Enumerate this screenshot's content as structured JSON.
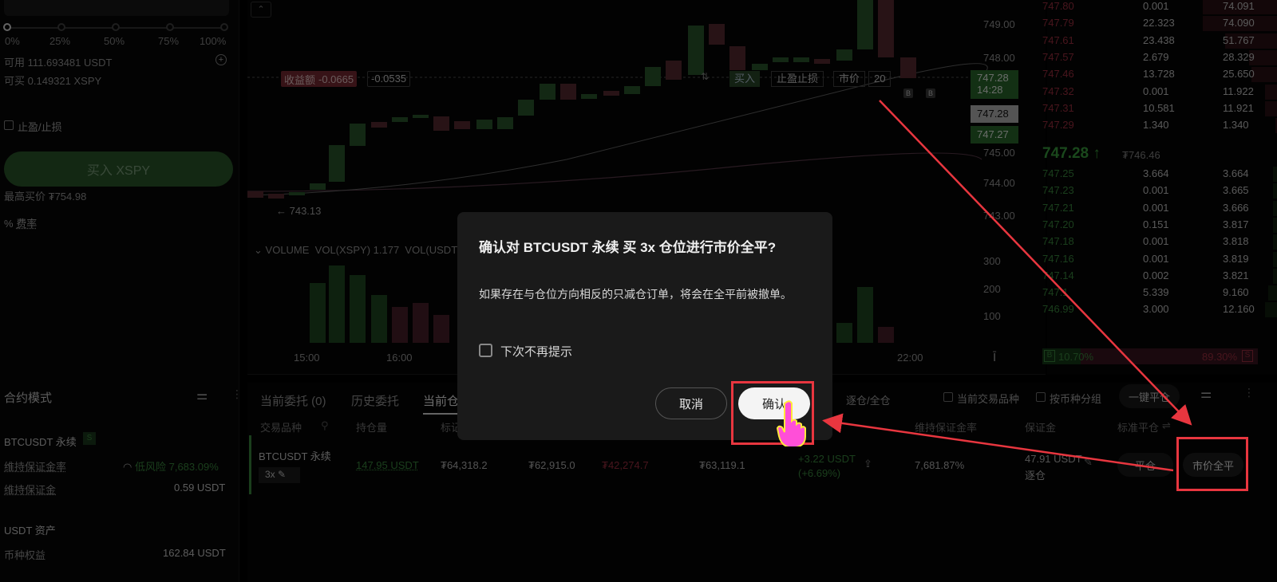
{
  "left_panel": {
    "slider_ticks": [
      "0%",
      "25%",
      "50%",
      "75%",
      "100%"
    ],
    "available_label": "可用",
    "available_value": "111.693481 USDT",
    "can_buy_label": "可买",
    "can_buy_value": "0.149321 XSPY",
    "tp_sl_label": "止盈/止损",
    "buy_button": "买入 XSPY",
    "max_price_label": "最高买价",
    "max_price_value": "₮754.98",
    "fee_label": "费率"
  },
  "chart": {
    "pnl_badge": "收益额",
    "pnl_value1": "-0.0665",
    "pnl_value2": "-0.0535",
    "order_tags": [
      "买入",
      "止盈止损",
      "市价",
      "20"
    ],
    "low_label": "← 743.13",
    "volume_label": "VOLUME",
    "vol_xspy": "VOL(XSPY) 1.177",
    "vol_usdt": "VOL(USDT",
    "x_ticks": [
      "15:00",
      "16:00",
      "22:00"
    ],
    "price_scale": [
      "749.00",
      "748.00",
      "747.28",
      "14:28",
      "747.28",
      "747.27",
      "745.00",
      "744.00",
      "743.00"
    ],
    "vol_scale": [
      "300",
      "200",
      "100"
    ]
  },
  "order_book": {
    "asks": [
      [
        "747.80",
        "0.001",
        "74.091"
      ],
      [
        "747.79",
        "22.323",
        "74.090"
      ],
      [
        "747.61",
        "23.438",
        "51.767"
      ],
      [
        "747.57",
        "2.679",
        "28.329"
      ],
      [
        "747.46",
        "13.728",
        "25.650"
      ],
      [
        "747.32",
        "0.001",
        "11.922"
      ],
      [
        "747.31",
        "10.581",
        "11.921"
      ],
      [
        "747.29",
        "1.340",
        "1.340"
      ]
    ],
    "last_price": "747.28 ↑",
    "mark_price": "₮746.46",
    "bids": [
      [
        "747.25",
        "3.664",
        "3.664"
      ],
      [
        "747.23",
        "0.001",
        "3.665"
      ],
      [
        "747.21",
        "0.001",
        "3.666"
      ],
      [
        "747.20",
        "0.151",
        "3.817"
      ],
      [
        "747.18",
        "0.001",
        "3.818"
      ],
      [
        "747.16",
        "0.001",
        "3.819"
      ],
      [
        "747.14",
        "0.002",
        "3.821"
      ],
      [
        "747.1",
        "5.339",
        "9.160"
      ],
      [
        "746.99",
        "3.000",
        "12.160"
      ]
    ],
    "buy_ratio": "10.70%",
    "sell_ratio": "89.30%",
    "b_label": "B",
    "s_label": "S"
  },
  "bottom_left": {
    "title": "合约模式",
    "symbol": "BTCUSDT 永续",
    "maint_rate_label": "维持保证金率",
    "risk_label": "低风险",
    "risk_value": "7,683.09%",
    "maint_margin_label": "维持保证金",
    "maint_margin_value": "0.59 USDT",
    "asset_title": "USDT 资产",
    "equity_label": "币种权益",
    "equity_value": "162.84 USDT"
  },
  "bottom": {
    "tabs": [
      "当前委托 (0)",
      "历史委托",
      "当前仓"
    ],
    "margin_mode": "逐仓/全仓",
    "filter_current": "当前交易品种",
    "filter_group": "按币种分组",
    "close_all_btn": "一键平仓",
    "headers": [
      "交易品种",
      "持仓量",
      "标记",
      "维持保证金率",
      "保证金",
      "标准平仓"
    ],
    "row": {
      "symbol": "BTCUSDT 永续",
      "leverage": "3x",
      "size": "147.95 USDT",
      "v1": "₮64,318.2",
      "v2": "₮62,915.0",
      "v3": "₮42,274.7",
      "v4": "₮63,119.1",
      "pnl": "+3.22 USDT",
      "pnl_pct": "(+6.69%)",
      "maint_rate": "7,681.87%",
      "margin": "47.91 USDT",
      "margin_mode": "逐仓",
      "close_btn": "平仓",
      "market_close_btn": "市价全平"
    }
  },
  "dialog": {
    "title": "确认对 BTCUSDT 永续 买 3x 仓位进行市价全平?",
    "body": "如果存在与仓位方向相反的只减仓订单，将会在全平前被撤单。",
    "checkbox_label": "下次不再提示",
    "cancel": "取消",
    "confirm": "确认"
  },
  "colors": {
    "up": "#3a8a3e",
    "down": "#8a2a3a",
    "highlight": "#e8363f",
    "cursor": "#ff4fd8"
  }
}
